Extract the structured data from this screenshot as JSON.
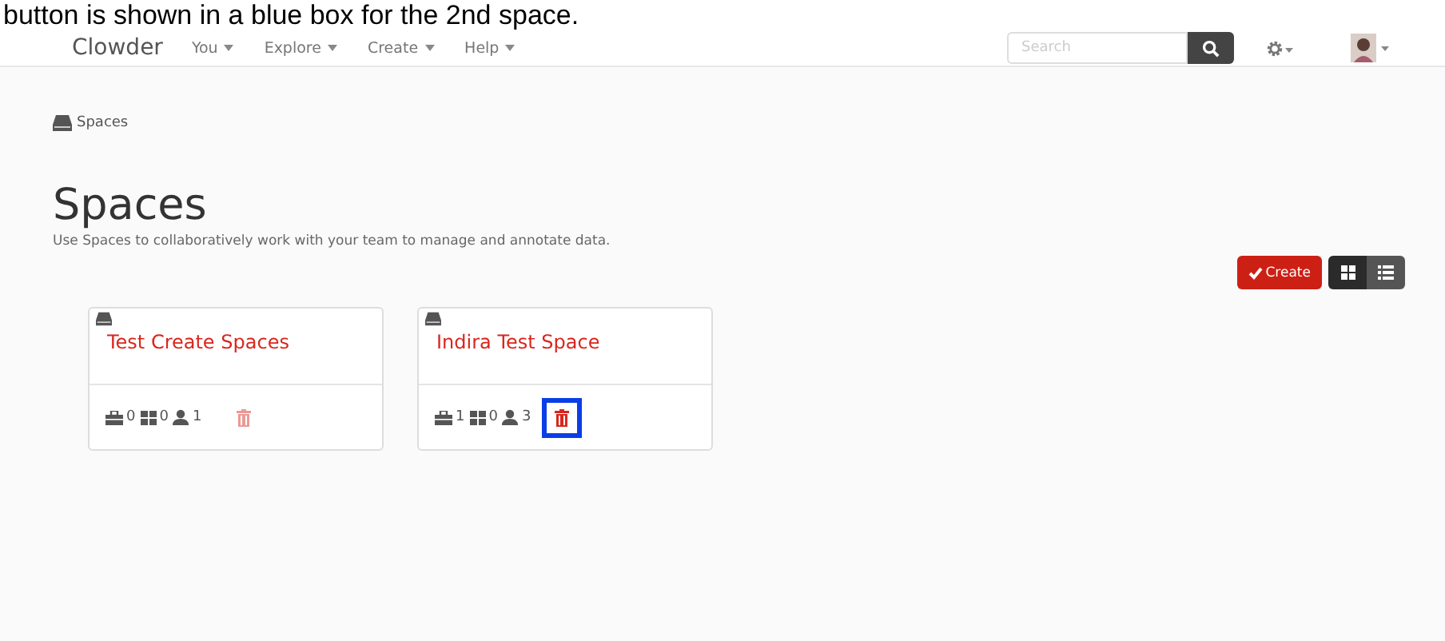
{
  "caption": "button is shown in a blue box for the 2nd space.",
  "navbar": {
    "brand": "Clowder",
    "menus": [
      {
        "label": "You"
      },
      {
        "label": "Explore"
      },
      {
        "label": "Create"
      },
      {
        "label": "Help"
      }
    ],
    "search": {
      "placeholder": "Search"
    }
  },
  "breadcrumb": "Spaces",
  "heading": "Spaces",
  "description": "Use Spaces to collaboratively work with your team to manage and annotate data.",
  "toolbar": {
    "create_label": "Create",
    "views": [
      {
        "kind": "grid",
        "selected": true
      },
      {
        "kind": "list",
        "selected": false
      }
    ]
  },
  "spaces": [
    {
      "title": "Test Create Spaces",
      "collections": "0",
      "datasets": "0",
      "users": "1",
      "highlighted": false
    },
    {
      "title": "Indira Test Space",
      "collections": "1",
      "datasets": "0",
      "users": "3",
      "highlighted": true
    }
  ]
}
